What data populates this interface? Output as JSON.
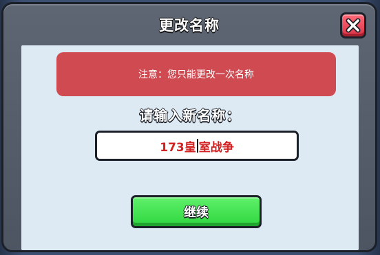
{
  "dialog": {
    "title": "更改名称",
    "close_icon": "close-x-icon",
    "notice_text": "注意：您只能更改一次名称",
    "prompt_label": "请输入新名称：",
    "name_input": {
      "value_before_caret": "173皇",
      "value_after_caret": "室战争"
    },
    "continue_label": "继续"
  },
  "colors": {
    "notice_bg": "#d04a52",
    "continue_bg": "#2ed63f",
    "close_bg": "#d93448",
    "input_text": "#d32020",
    "content_bg": "#ddeaf4"
  }
}
